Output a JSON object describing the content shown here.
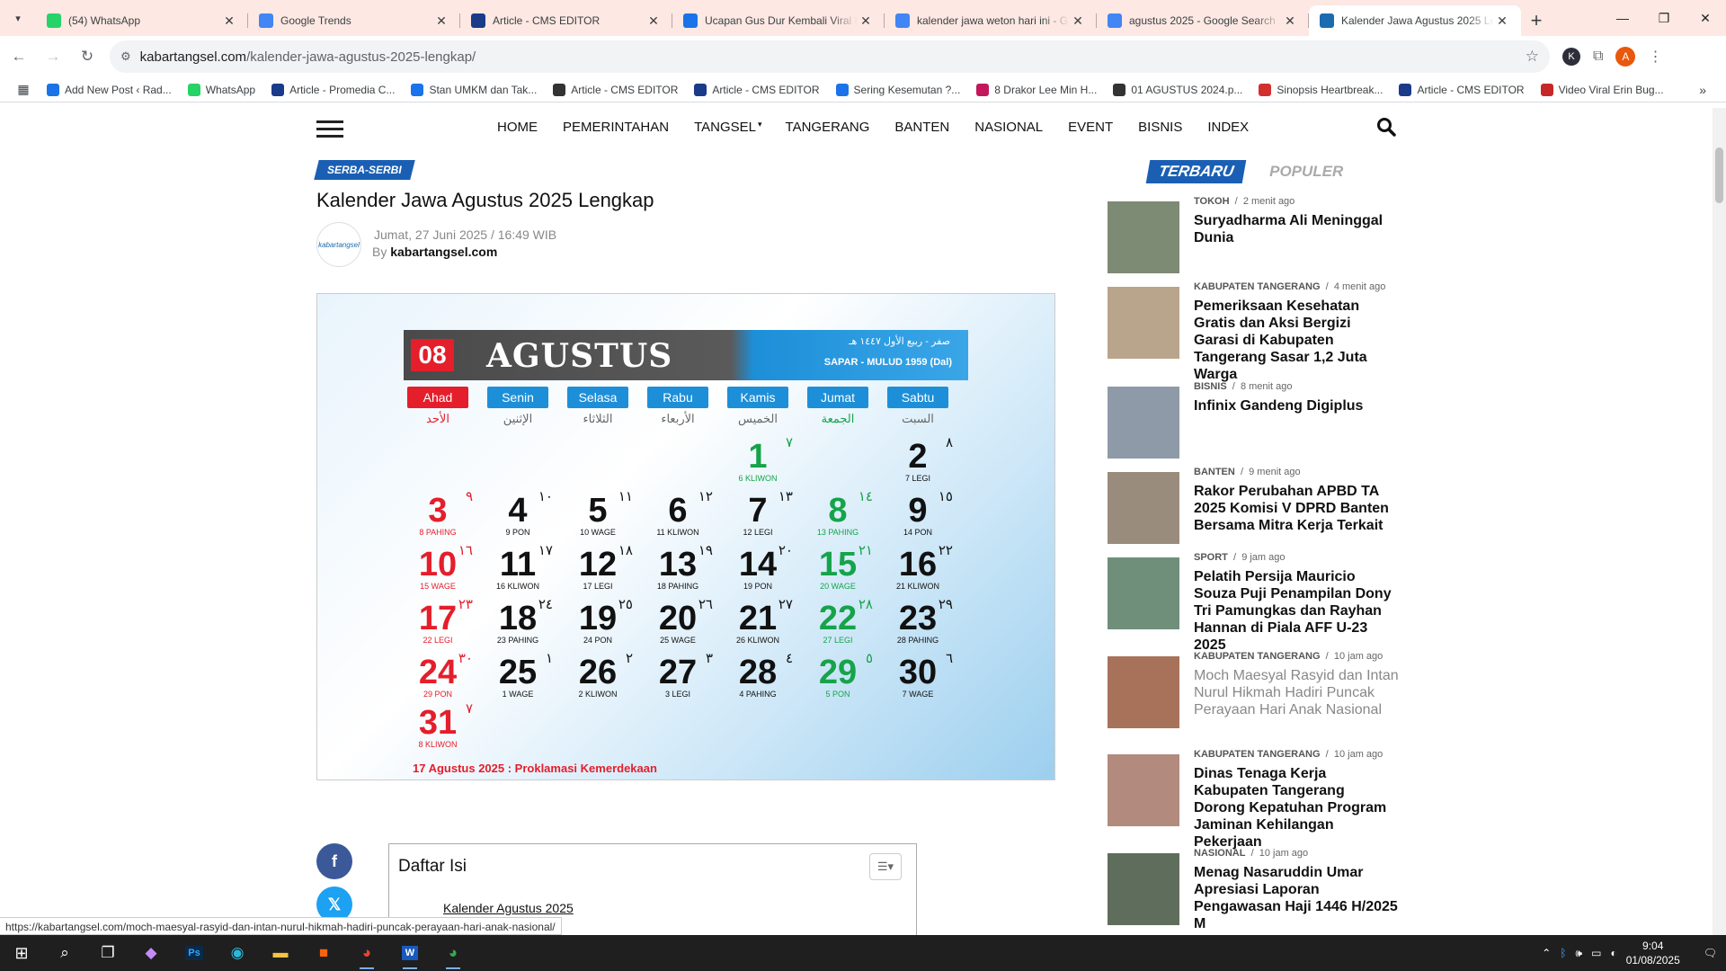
{
  "browser": {
    "tabs": [
      {
        "title": "(54) WhatsApp",
        "icon": "whatsapp-icon",
        "color": "#25d366"
      },
      {
        "title": "Google Trends",
        "icon": "trends-icon",
        "color": "#4285f4"
      },
      {
        "title": "Article - CMS EDITOR",
        "icon": "cms-icon",
        "color": "#1a3a8a"
      },
      {
        "title": "Ucapan Gus Dur Kembali Viral I",
        "icon": "bookmark-icon",
        "color": "#1a73e8"
      },
      {
        "title": "kalender jawa weton hari ini - G",
        "icon": "google-icon",
        "color": "#4285f4"
      },
      {
        "title": "agustus 2025 - Google Search",
        "icon": "google-icon",
        "color": "#4285f4"
      },
      {
        "title": "Kalender Jawa Agustus 2025 Le",
        "icon": "site-icon",
        "color": "#1a6bb0"
      }
    ],
    "url_domain": "kabartangsel.com",
    "url_path": "/kalender-jawa-agustus-2025-lengkap/",
    "bookmarks": [
      {
        "label": "Add New Post ‹ Rad...",
        "color": "#1a73e8"
      },
      {
        "label": "WhatsApp",
        "color": "#25d366"
      },
      {
        "label": "Article - Promedia C...",
        "color": "#1a3a8a"
      },
      {
        "label": "Stan UMKM dan Tak...",
        "color": "#1a73e8"
      },
      {
        "label": "Article - CMS EDITOR",
        "color": "#333333"
      },
      {
        "label": "Article - CMS EDITOR",
        "color": "#1a3a8a"
      },
      {
        "label": "Sering Kesemutan ?...",
        "color": "#1a73e8"
      },
      {
        "label": "8 Drakor Lee Min H...",
        "color": "#c2185b"
      },
      {
        "label": "01 AGUSTUS 2024.p...",
        "color": "#333333"
      },
      {
        "label": "Sinopsis Heartbreak...",
        "color": "#d32f2f"
      },
      {
        "label": "Article - CMS EDITOR",
        "color": "#1a3a8a"
      },
      {
        "label": "Video Viral Erin Bug...",
        "color": "#c62828"
      }
    ],
    "profile_k": "K",
    "profile_a": "A"
  },
  "site": {
    "menu": [
      "HOME",
      "PEMERINTAHAN",
      "TANGSEL",
      "TANGERANG",
      "BANTEN",
      "NASIONAL",
      "EVENT",
      "BISNIS",
      "INDEX"
    ],
    "category": "SERBA-SERBI",
    "title": "Kalender Jawa Agustus 2025 Lengkap",
    "date": "Jumat, 27 Juni 2025 / 16:49 WIB",
    "by": "By",
    "author": "kabartangsel.com",
    "logo_text": "kabartangsel"
  },
  "calendar": {
    "day_badge": "08",
    "month": "AGUSTUS",
    "arabic_months": "صفر - ربيع الأول ١٤٤٧ هـ",
    "javanese_months": "SAPAR - MULUD 1959 (Dal)",
    "weekdays": [
      "Ahad",
      "Senin",
      "Selasa",
      "Rabu",
      "Kamis",
      "Jumat",
      "Sabtu"
    ],
    "weekdays_arabic": [
      "الأحد",
      "الإثنين",
      "الثلاثاء",
      "الأربعاء",
      "الخميس",
      "الجمعة",
      "السبت"
    ],
    "colors": {
      "red": "#e51e2b",
      "blue": "#1d8fd8",
      "green": "#16a34a"
    },
    "days": [
      {
        "d": "1",
        "p": "6 KLIWON",
        "h": "٧",
        "col": 4,
        "row": 0,
        "c": "grn"
      },
      {
        "d": "2",
        "p": "7 LEGI",
        "h": "٨",
        "col": 6,
        "row": 0,
        "c": "blk"
      },
      {
        "d": "3",
        "p": "8 PAHING",
        "h": "٩",
        "col": 0,
        "row": 1,
        "c": "red"
      },
      {
        "d": "4",
        "p": "9 PON",
        "h": "١٠",
        "col": 1,
        "row": 1,
        "c": "blk"
      },
      {
        "d": "5",
        "p": "10 WAGE",
        "h": "١١",
        "col": 2,
        "row": 1,
        "c": "blk"
      },
      {
        "d": "6",
        "p": "11 KLIWON",
        "h": "١٢",
        "col": 3,
        "row": 1,
        "c": "blk"
      },
      {
        "d": "7",
        "p": "12 LEGI",
        "h": "١٣",
        "col": 4,
        "row": 1,
        "c": "blk"
      },
      {
        "d": "8",
        "p": "13 PAHING",
        "h": "١٤",
        "col": 5,
        "row": 1,
        "c": "grn"
      },
      {
        "d": "9",
        "p": "14 PON",
        "h": "١٥",
        "col": 6,
        "row": 1,
        "c": "blk"
      },
      {
        "d": "10",
        "p": "15 WAGE",
        "h": "١٦",
        "col": 0,
        "row": 2,
        "c": "red"
      },
      {
        "d": "11",
        "p": "16 KLIWON",
        "h": "١٧",
        "col": 1,
        "row": 2,
        "c": "blk"
      },
      {
        "d": "12",
        "p": "17 LEGI",
        "h": "١٨",
        "col": 2,
        "row": 2,
        "c": "blk"
      },
      {
        "d": "13",
        "p": "18 PAHING",
        "h": "١٩",
        "col": 3,
        "row": 2,
        "c": "blk"
      },
      {
        "d": "14",
        "p": "19 PON",
        "h": "٢٠",
        "col": 4,
        "row": 2,
        "c": "blk"
      },
      {
        "d": "15",
        "p": "20 WAGE",
        "h": "٢١",
        "col": 5,
        "row": 2,
        "c": "grn"
      },
      {
        "d": "16",
        "p": "21 KLIWON",
        "h": "٢٢",
        "col": 6,
        "row": 2,
        "c": "blk"
      },
      {
        "d": "17",
        "p": "22 LEGI",
        "h": "٢٣",
        "col": 0,
        "row": 3,
        "c": "red"
      },
      {
        "d": "18",
        "p": "23 PAHING",
        "h": "٢٤",
        "col": 1,
        "row": 3,
        "c": "blk"
      },
      {
        "d": "19",
        "p": "24 PON",
        "h": "٢٥",
        "col": 2,
        "row": 3,
        "c": "blk"
      },
      {
        "d": "20",
        "p": "25 WAGE",
        "h": "٢٦",
        "col": 3,
        "row": 3,
        "c": "blk"
      },
      {
        "d": "21",
        "p": "26 KLIWON",
        "h": "٢٧",
        "col": 4,
        "row": 3,
        "c": "blk"
      },
      {
        "d": "22",
        "p": "27 LEGI",
        "h": "٢٨",
        "col": 5,
        "row": 3,
        "c": "grn"
      },
      {
        "d": "23",
        "p": "28 PAHING",
        "h": "٢٩",
        "col": 6,
        "row": 3,
        "c": "blk"
      },
      {
        "d": "24",
        "p": "29 PON",
        "h": "٣٠",
        "col": 0,
        "row": 4,
        "c": "red"
      },
      {
        "d": "25",
        "p": "1 WAGE",
        "h": "١",
        "col": 1,
        "row": 4,
        "c": "blk"
      },
      {
        "d": "26",
        "p": "2 KLIWON",
        "h": "٢",
        "col": 2,
        "row": 4,
        "c": "blk"
      },
      {
        "d": "27",
        "p": "3 LEGI",
        "h": "٣",
        "col": 3,
        "row": 4,
        "c": "blk"
      },
      {
        "d": "28",
        "p": "4 PAHING",
        "h": "٤",
        "col": 4,
        "row": 4,
        "c": "blk"
      },
      {
        "d": "29",
        "p": "5 PON",
        "h": "٥",
        "col": 5,
        "row": 4,
        "c": "grn"
      },
      {
        "d": "30",
        "p": "7 WAGE",
        "h": "٦",
        "col": 6,
        "row": 4,
        "c": "blk"
      },
      {
        "d": "31",
        "p": "8 KLIWON",
        "h": "٧",
        "col": 0,
        "row": 5,
        "c": "red"
      }
    ],
    "footer": "17 Agustus 2025 : Proklamasi Kemerdekaan"
  },
  "share": [
    {
      "name": "facebook-share-button",
      "glyph": "f",
      "color": "#3b5998"
    },
    {
      "name": "x-share-button",
      "glyph": "𝕏",
      "color": "#1da1f2"
    }
  ],
  "toc": {
    "title": "Daftar Isi",
    "item": "Kalender Agustus 2025"
  },
  "sidebar": {
    "tab_latest": "TERBARU",
    "tab_popular": "POPULER",
    "posts": [
      {
        "cat": "TOKOH",
        "time": "2 menit ago",
        "title": "Suryadharma Ali Meninggal Dunia",
        "thumb": "#7d8a74"
      },
      {
        "cat": "KABUPATEN TANGERANG",
        "time": "4 menit ago",
        "title": "Pemeriksaan Kesehatan Gratis dan Aksi Bergizi Garasi di Kabupaten Tangerang Sasar 1,2 Juta Warga",
        "thumb": "#b9a48c"
      },
      {
        "cat": "BISNIS",
        "time": "8 menit ago",
        "title": "Infinix Gandeng Digiplus",
        "thumb": "#8f9aa8"
      },
      {
        "cat": "BANTEN",
        "time": "9 menit ago",
        "title": "Rakor Perubahan APBD TA 2025 Komisi V DPRD Banten Bersama Mitra Kerja Terkait",
        "thumb": "#9a8c7c"
      },
      {
        "cat": "SPORT",
        "time": "9 jam ago",
        "title": "Pelatih Persija Mauricio Souza Puji Penampilan Dony Tri Pamungkas dan Rayhan Hannan di Piala AFF U-23 2025",
        "thumb": "#6f8f7a"
      },
      {
        "cat": "KABUPATEN TANGERANG",
        "time": "10 jam ago",
        "title": "Moch Maesyal Rasyid dan Intan Nurul Hikmah Hadiri Puncak Perayaan Hari Anak Nasional",
        "thumb": "#a8725a"
      },
      {
        "cat": "KABUPATEN TANGERANG",
        "time": "10 jam ago",
        "title": "Dinas Tenaga Kerja Kabupaten Tangerang Dorong Kepatuhan Program Jaminan Kehilangan Pekerjaan",
        "thumb": "#b28a7e"
      },
      {
        "cat": "NASIONAL",
        "time": "10 jam ago",
        "title": "Menag Nasaruddin Umar Apresiasi Laporan Pengawasan Haji 1446 H/2025 M",
        "thumb": "#5f6e5c"
      }
    ]
  },
  "status_url": "https://kabartangsel.com/moch-maesyal-rasyid-dan-intan-nurul-hikmah-hadiri-puncak-perayaan-hari-anak-nasional/",
  "taskbar": {
    "time": "9:04",
    "date": "01/08/2025"
  }
}
